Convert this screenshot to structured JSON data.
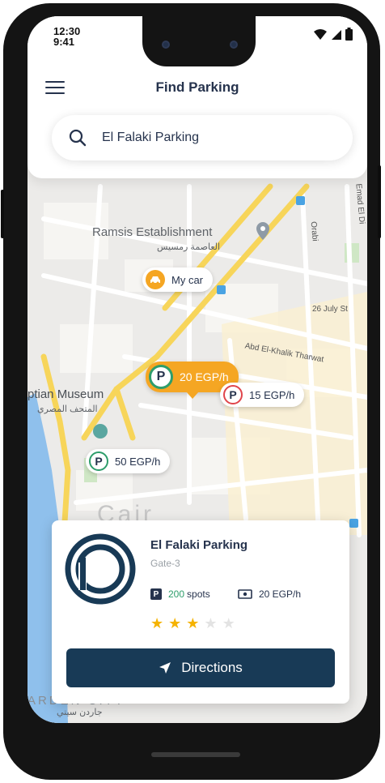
{
  "status_bar": {
    "time_primary": "12:30",
    "time_secondary": "9:41"
  },
  "header": {
    "title": "Find Parking",
    "menu_icon": "hamburger-icon"
  },
  "search": {
    "value": "El Falaki Parking",
    "icon": "search-icon"
  },
  "map": {
    "labels": {
      "ramsis_en": "Ramsis Establishment",
      "ramsis_ar": "العاصمة رمسيس",
      "museum_en": "ptian Museum",
      "museum_ar": "المتحف المصري",
      "street_26july": "26 July St",
      "street_abdelkhalik": "Abd El-Khalik Tharwat",
      "street_orabi": "Orabi",
      "street_emad": "Emad El Di",
      "garden_en": "ARDEN CITY",
      "garden_ar": "جاردن سيتي",
      "cairo_partial": "Cair"
    },
    "pins": {
      "my_car": "My car",
      "selected_price": "20 EGP/h",
      "pin_15": "15 EGP/h",
      "pin_50": "50 EGP/h",
      "parking_letter": "P"
    },
    "colors": {
      "accent_orange": "#f5a623",
      "green": "#2e9d6b",
      "red": "#e0454b"
    }
  },
  "card": {
    "name": "El Falaki Parking",
    "subtitle": "Gate-3",
    "spots_count": "200",
    "spots_label": "spots",
    "price": "20 EGP/h",
    "rating": 3,
    "rating_max": 5,
    "button_label": "Directions",
    "colors": {
      "navy": "#183a56",
      "star_on": "#f5b301",
      "star_off": "#e3e3e3"
    }
  }
}
